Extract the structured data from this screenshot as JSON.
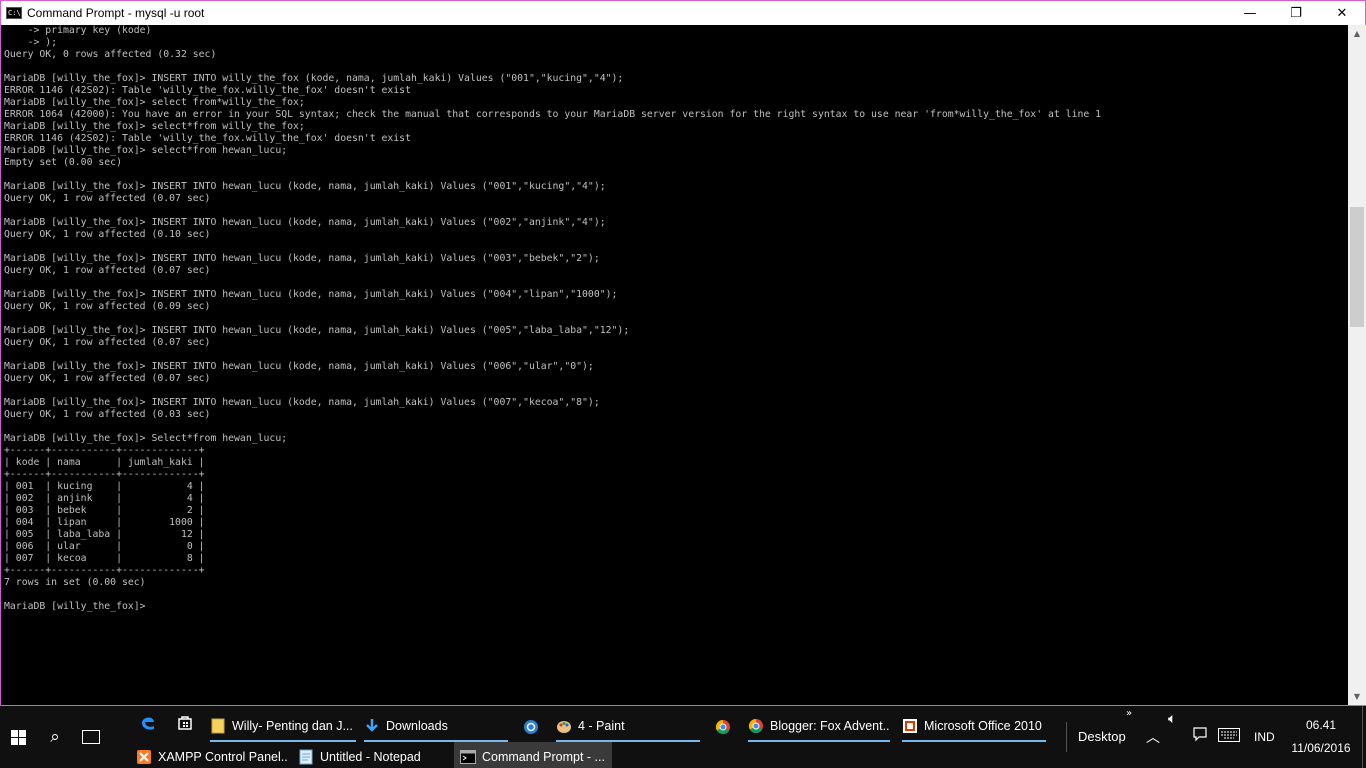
{
  "window": {
    "title": "Command Prompt - mysql  -u root",
    "minimize": "—",
    "maximize": "❐",
    "close": "✕"
  },
  "console": {
    "lines": [
      "    -> primary key (kode)",
      "    -> );",
      "Query OK, 0 rows affected (0.32 sec)",
      "",
      "MariaDB [willy_the_fox]> INSERT INTO willy_the_fox (kode, nama, jumlah_kaki) Values (\"001\",\"kucing\",\"4\");",
      "ERROR 1146 (42S02): Table 'willy_the_fox.willy_the_fox' doesn't exist",
      "MariaDB [willy_the_fox]> select from*willy_the_fox;",
      "ERROR 1064 (42000): You have an error in your SQL syntax; check the manual that corresponds to your MariaDB server version for the right syntax to use near 'from*willy_the_fox' at line 1",
      "MariaDB [willy_the_fox]> select*from willy_the_fox;",
      "ERROR 1146 (42S02): Table 'willy_the_fox.willy_the_fox' doesn't exist",
      "MariaDB [willy_the_fox]> select*from hewan_lucu;",
      "Empty set (0.00 sec)",
      "",
      "MariaDB [willy_the_fox]> INSERT INTO hewan_lucu (kode, nama, jumlah_kaki) Values (\"001\",\"kucing\",\"4\");",
      "Query OK, 1 row affected (0.07 sec)",
      "",
      "MariaDB [willy_the_fox]> INSERT INTO hewan_lucu (kode, nama, jumlah_kaki) Values (\"002\",\"anjink\",\"4\");",
      "Query OK, 1 row affected (0.10 sec)",
      "",
      "MariaDB [willy_the_fox]> INSERT INTO hewan_lucu (kode, nama, jumlah_kaki) Values (\"003\",\"bebek\",\"2\");",
      "Query OK, 1 row affected (0.07 sec)",
      "",
      "MariaDB [willy_the_fox]> INSERT INTO hewan_lucu (kode, nama, jumlah_kaki) Values (\"004\",\"lipan\",\"1000\");",
      "Query OK, 1 row affected (0.09 sec)",
      "",
      "MariaDB [willy_the_fox]> INSERT INTO hewan_lucu (kode, nama, jumlah_kaki) Values (\"005\",\"laba_laba\",\"12\");",
      "Query OK, 1 row affected (0.07 sec)",
      "",
      "MariaDB [willy_the_fox]> INSERT INTO hewan_lucu (kode, nama, jumlah_kaki) Values (\"006\",\"ular\",\"0\");",
      "Query OK, 1 row affected (0.07 sec)",
      "",
      "MariaDB [willy_the_fox]> INSERT INTO hewan_lucu (kode, nama, jumlah_kaki) Values (\"007\",\"kecoa\",\"8\");",
      "Query OK, 1 row affected (0.03 sec)",
      "",
      "MariaDB [willy_the_fox]> Select*from hewan_lucu;",
      "+------+-----------+-------------+",
      "| kode | nama      | jumlah_kaki |",
      "+------+-----------+-------------+",
      "| 001  | kucing    |           4 |",
      "| 002  | anjink    |           4 |",
      "| 003  | bebek     |           2 |",
      "| 004  | lipan     |        1000 |",
      "| 005  | laba_laba |          12 |",
      "| 006  | ular      |           0 |",
      "| 007  | kecoa     |           8 |",
      "+------+-----------+-------------+",
      "7 rows in set (0.00 sec)",
      "",
      "MariaDB [willy_the_fox]> "
    ]
  },
  "taskbar": {
    "row1": [
      {
        "label": "Willy- Penting dan J...",
        "icon": "folder-icon"
      },
      {
        "label": "Downloads",
        "icon": "download-icon"
      },
      {
        "label": "4 - Paint",
        "icon": "paint-icon"
      },
      {
        "label": "Blogger: Fox Advent...",
        "icon": "chrome-icon"
      },
      {
        "label": "Microsoft Office 2010",
        "icon": "office-icon"
      }
    ],
    "row2": [
      {
        "label": "XAMPP Control Panel...",
        "icon": "xampp-icon"
      },
      {
        "label": "Untitled - Notepad",
        "icon": "notepad-icon"
      },
      {
        "label": "Command Prompt - ...",
        "icon": "cmd-icon"
      }
    ],
    "desktop_label": "Desktop",
    "language": "IND",
    "time": "06.41",
    "date": "11/06/2016"
  }
}
